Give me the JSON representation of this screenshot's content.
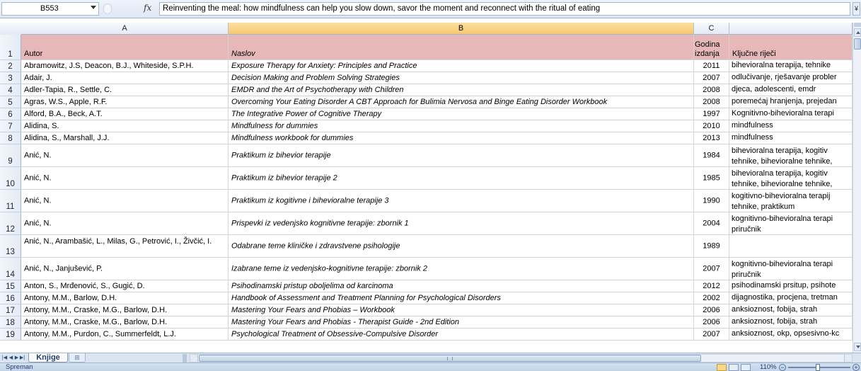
{
  "formula_bar": {
    "name_box": "B553",
    "fx_label": "fx",
    "content": "Reinventing the meal: how mindfulness can help you slow down, savor the moment and reconnect with the ritual of eating",
    "expand": "¥"
  },
  "columns": [
    "A",
    "B",
    "C",
    ""
  ],
  "selected_column": "B",
  "header_row": {
    "num": "1",
    "autor": "Autor",
    "naslov": "Naslov",
    "godina": "Godina izdanja",
    "kljucne": "Ključne riječi"
  },
  "rows": [
    {
      "num": "2",
      "autor": "Abramowitz, J.S, Deacon, B.J., Whiteside, S.P.H.",
      "naslov": "Exposure Therapy for Anxiety: Principles and Practice",
      "godina": "2011",
      "kljucne": "anksiozni poremećaji, izlaganje bihevioralna terapija, tehnike"
    },
    {
      "num": "3",
      "autor": "Adair, J.",
      "naslov": "Decision Making and Problem Solving Strategies",
      "godina": "2007",
      "kljucne": "odlučivanje, rješavanje probler"
    },
    {
      "num": "4",
      "autor": "Adler-Tapia, R., Settle, C.",
      "naslov": "EMDR and the Art of Psychotherapy with Children",
      "godina": "2008",
      "kljucne": "djeca, adolescenti, emdr"
    },
    {
      "num": "5",
      "autor": "Agras, W.S., Apple, R.F.",
      "naslov": "Overcoming Your Eating Disorder A CBT Approach for Bulimia Nervosa and Binge Eating Disorder  Workbook",
      "godina": "2008",
      "kljucne": "poremećaj hranjenja, prejedan"
    },
    {
      "num": "6",
      "autor": "Alford, B.A., Beck, A.T.",
      "naslov": "The Integrative Power of Cognitive Therapy",
      "godina": "1997",
      "kljucne": "Kognitivno-bihevioralna terapi"
    },
    {
      "num": "7",
      "autor": "Alidina, S.",
      "naslov": "Mindfulness for dummies",
      "godina": "2010",
      "kljucne": "mindfulness"
    },
    {
      "num": "8",
      "autor": "Alidina, S., Marshall, J.J.",
      "naslov": "Mindfulness workbook for dummies",
      "godina": "2013",
      "kljucne": "mindfulness"
    },
    {
      "num": "9",
      "autor": "Anić, N.",
      "naslov": "Praktikum iz bihevior terapije",
      "godina": "1984",
      "kljucne": "bihevioralna terapija, kogitiv tehnike, bihevioralne tehnike,"
    },
    {
      "num": "10",
      "autor": "Anić, N.",
      "naslov": "Praktikum iz bihevior terapije 2",
      "godina": "1985",
      "kljucne": "bihevioralna terapija, kogitiv tehnike, bihevioralne tehnike,"
    },
    {
      "num": "11",
      "autor": "Anić, N.",
      "naslov": "Praktikum iz kogitivne i bihevioralne terapije 3",
      "godina": "1990",
      "kljucne": "kogitivno-bihevioralna terapij tehnike, praktikum"
    },
    {
      "num": "12",
      "autor": "Anić, N.",
      "naslov": "Prispevki iz vedenjsko kognitivne terapije: zbornik 1",
      "godina": "2004",
      "kljucne": "kognitivno-bihevioralna terapi priručnik"
    },
    {
      "num": "13",
      "autor": "Anić, N., Arambašić, L., Milas, G., Petrović, I., Živčić, I.",
      "naslov": "Odabrane teme kliničke i zdravstvene psihologije",
      "godina": "1989",
      "kljucne": ""
    },
    {
      "num": "14",
      "autor": "Anić, N., Janjušević, P.",
      "naslov": "Izabrane teme iz vedenjsko-kognitivne terapije: zbornik 2",
      "godina": "2007",
      "kljucne": "kognitivno-bihevioralna terapi priručnik"
    },
    {
      "num": "15",
      "autor": "Anton, S., Mrđenović, S., Gugić, D.",
      "naslov": "Psihodinamski pristup oboljelima od karcinoma",
      "godina": "2012",
      "kljucne": "psihodinamski prsitup, psihote"
    },
    {
      "num": "16",
      "autor": "Antony, M.M., Barlow, D.H.",
      "naslov": "Handbook of Assessment and Treatment Planning for Psychological Disorders",
      "godina": "2002",
      "kljucne": "dijagnostika, procjena, tretman"
    },
    {
      "num": "17",
      "autor": "Antony, M.M., Craske, M.G., Barlow, D.H.",
      "naslov": "Mastering Your Fears and Phobias – Workbook",
      "godina": "2006",
      "kljucne": "anksioznost, fobija, strah"
    },
    {
      "num": "18",
      "autor": "Antony, M.M., Craske, M.G., Barlow, D.H.",
      "naslov": "Mastering Your Fears and Phobias - Therapist Guide - 2nd Edition",
      "godina": "2006",
      "kljucne": "anksioznost, fobija, strah"
    },
    {
      "num": "19",
      "autor": "Antony, M.M., Purdon, C., Summerfeldt, L.J.",
      "naslov": "Psychological Treatment of Obsessive-Compulsive Disorder",
      "godina": "2007",
      "kljucne": "anksioznost, okp, opsesivno-kc"
    }
  ],
  "sheet_tabs": [
    "Knjige"
  ],
  "status_text": "Spreman",
  "zoom": "110%",
  "colors": {
    "header_fill": "#e6b9b8",
    "selected_column": "#f5c870",
    "chrome": "#dbe5f2"
  }
}
